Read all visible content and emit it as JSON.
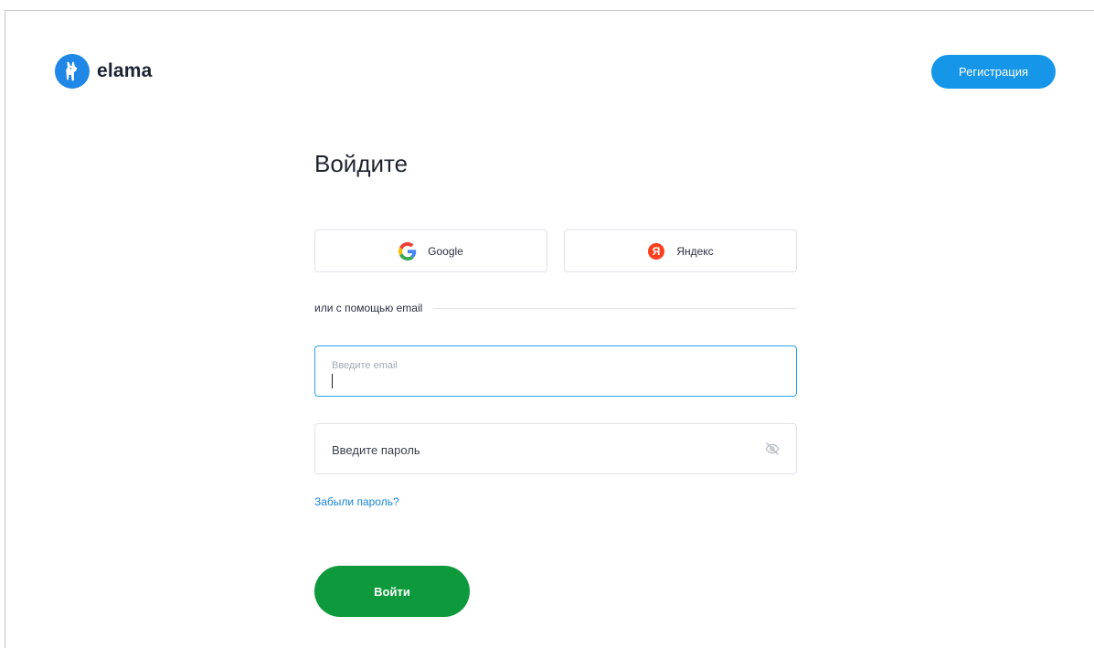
{
  "header": {
    "logo_text": "elama",
    "register_label": "Регистрация"
  },
  "login": {
    "title": "Войдите",
    "google_label": "Google",
    "yandex_label": "Яндекс",
    "yandex_icon_letter": "Я",
    "divider_text": "или с помощью email",
    "email_label": "Введите email",
    "email_value": "",
    "password_placeholder": "Введите пароль",
    "forgot_label": "Забыли пароль?",
    "submit_label": "Войти"
  },
  "icons": {
    "logo": "llama-logo-icon",
    "google": "google-icon",
    "yandex": "yandex-icon",
    "password_toggle": "eye-off-icon"
  },
  "colors": {
    "brand_blue": "#1f87e5",
    "register_button": "#1696e8",
    "email_focus_border": "#2aa6e6",
    "link": "#1686d8",
    "submit_button": "#0e9a3c",
    "yandex_red": "#fc3f1d"
  }
}
